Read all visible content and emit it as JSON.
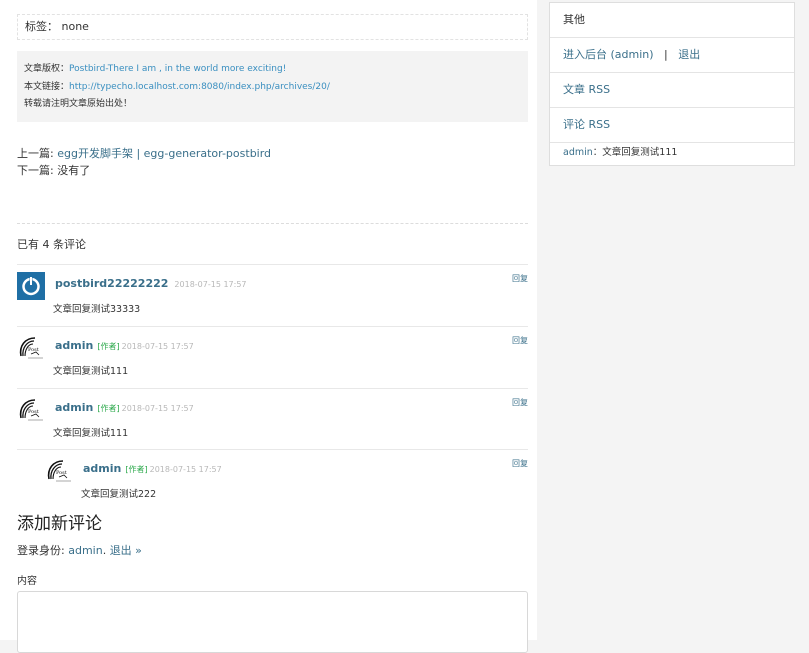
{
  "tags": {
    "label": "标签：",
    "value": "none"
  },
  "copyright": {
    "line1_label": "文章版权：",
    "line1_link": "Postbird-There I am , in the world more exciting!",
    "line2_label": "本文链接：",
    "line2_link": "http://typecho.localhost.com:8080/index.php/archives/20/",
    "line3": "转载请注明文章原始出处！"
  },
  "prevnext": {
    "prev_label": "上一篇:",
    "prev_link": "egg开发脚手架 | egg-generator-postbird",
    "next_label": "下一篇:",
    "next_value": "没有了"
  },
  "comments_count": "已有 4 条评论",
  "comments": [
    {
      "author": "postbird22222222",
      "badge": "",
      "time": "2018-07-15 17:57",
      "body": "文章回复测试33333",
      "reply": "回复",
      "avatar": "power-icon",
      "indent": false
    },
    {
      "author": "admin",
      "badge": "[作者]",
      "time": "2018-07-15 17:57",
      "body": "文章回复测试111",
      "reply": "回复",
      "avatar": "postbird-logo",
      "indent": false
    },
    {
      "author": "admin",
      "badge": "[作者]",
      "time": "2018-07-15 17:57",
      "body": "文章回复测试111",
      "reply": "回复",
      "avatar": "postbird-logo",
      "indent": false
    },
    {
      "author": "admin",
      "badge": "[作者]",
      "time": "2018-07-15 17:57",
      "body": "文章回复测试222",
      "reply": "回复",
      "avatar": "postbird-logo",
      "indent": true
    }
  ],
  "add_comment": {
    "title": "添加新评论",
    "login_prefix": "登录身份:",
    "login_user": "admin",
    "logout": "退出 »",
    "content_label": "内容",
    "content_value": ""
  },
  "sidebar": {
    "heading": "其他",
    "admin_link": "进入后台 (admin)",
    "separator": "|",
    "logout_link": "退出",
    "article_rss": "文章 RSS",
    "comment_rss": "评论 RSS",
    "recent_author": "admin",
    "recent_sep": "：",
    "recent_text": "文章回复测试111"
  },
  "colors": {
    "link": "#3a6f8a",
    "badge": "#2aa84a",
    "time": "#b8b8b8",
    "avatar_blue": "#1f6fa5"
  }
}
